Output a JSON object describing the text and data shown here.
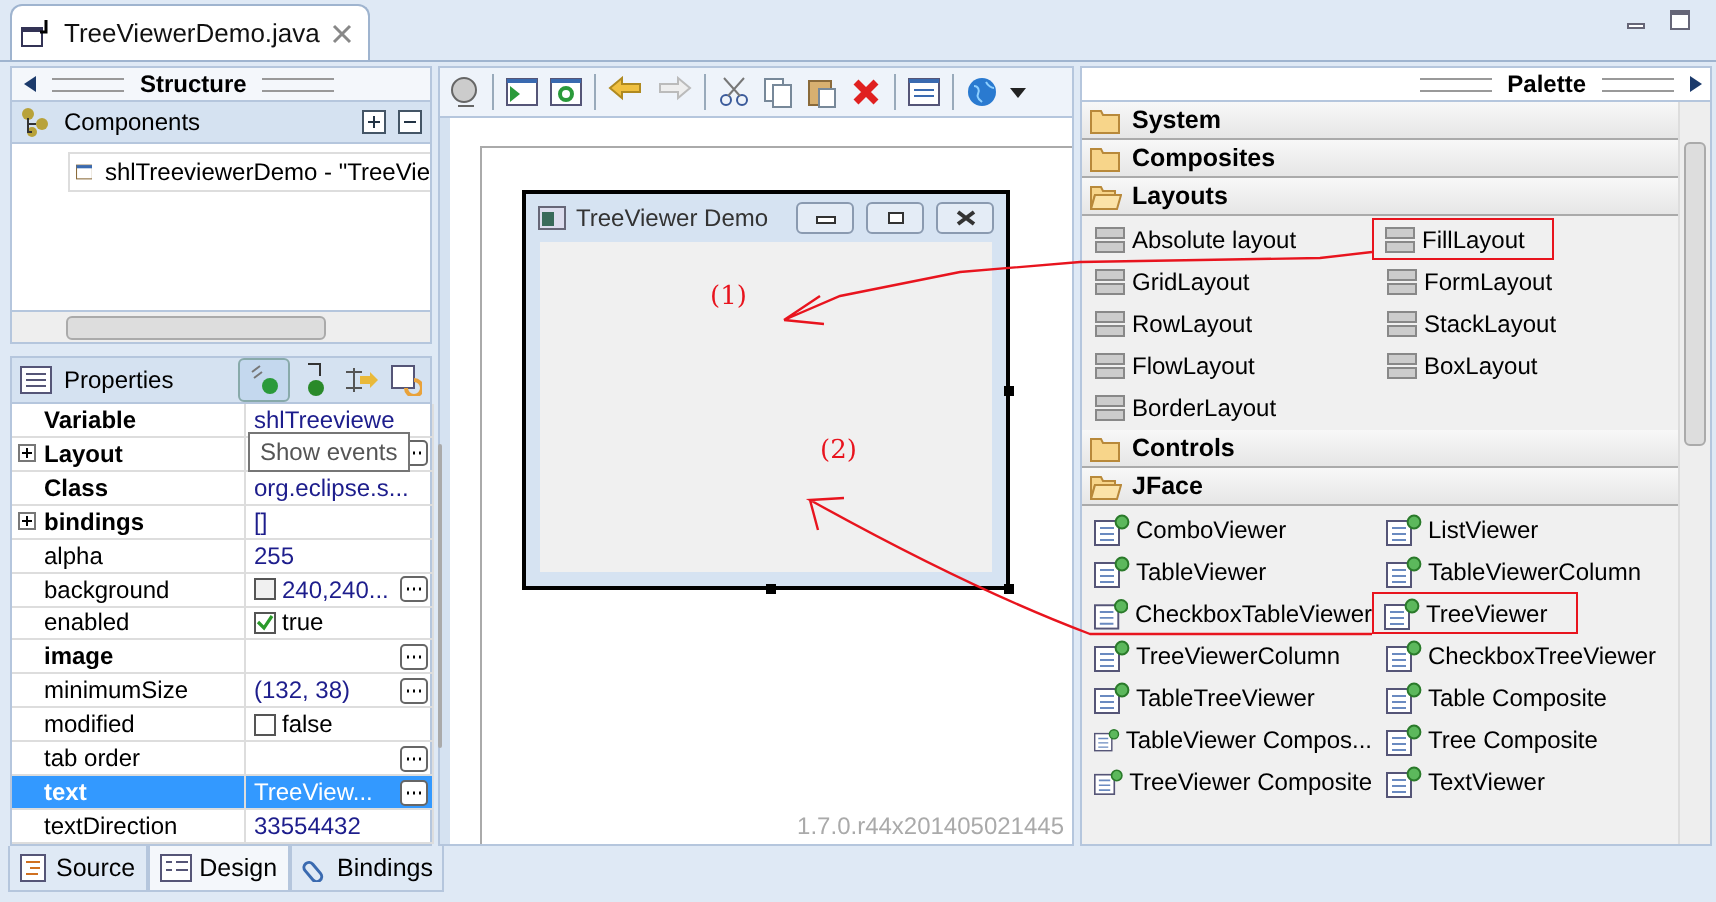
{
  "editor_tab": {
    "title": "TreeViewerDemo.java"
  },
  "structure": {
    "title": "Structure",
    "components_title": "Components",
    "tree": [
      {
        "label": "shlTreeviewerDemo - \"TreeVie",
        "selected": false
      }
    ]
  },
  "properties": {
    "title": "Properties",
    "tooltip": "Show events",
    "rows": [
      {
        "name": "Variable",
        "bold": true,
        "expandable": false,
        "kind": "text",
        "value": "shlTreeviewe",
        "button": false,
        "selected": false
      },
      {
        "name": "Layout",
        "bold": true,
        "expandable": true,
        "kind": "text",
        "button": true,
        "selected": false
      },
      {
        "name": "Class",
        "bold": true,
        "expandable": false,
        "kind": "text",
        "value": "org.eclipse.s...",
        "button": false,
        "selected": false
      },
      {
        "name": "bindings",
        "bold": true,
        "expandable": true,
        "kind": "text",
        "value": "[]",
        "button": false,
        "selected": false
      },
      {
        "name": "alpha",
        "bold": false,
        "expandable": false,
        "kind": "text",
        "value": "255",
        "button": false,
        "selected": false
      },
      {
        "name": "background",
        "bold": false,
        "expandable": false,
        "kind": "color",
        "value": "240,240...",
        "button": true,
        "selected": false
      },
      {
        "name": "enabled",
        "bold": false,
        "expandable": false,
        "kind": "check",
        "checked": true,
        "value": "true",
        "button": false,
        "selected": false
      },
      {
        "name": "image",
        "bold": true,
        "expandable": false,
        "kind": "text",
        "button": true,
        "selected": false
      },
      {
        "name": "minimumSize",
        "bold": false,
        "expandable": false,
        "kind": "text",
        "value": "(132, 38)",
        "button": true,
        "selected": false
      },
      {
        "name": "modified",
        "bold": false,
        "expandable": false,
        "kind": "check",
        "checked": false,
        "value": "false",
        "button": false,
        "selected": false
      },
      {
        "name": "tab order",
        "bold": false,
        "expandable": false,
        "kind": "text",
        "button": true,
        "selected": false
      },
      {
        "name": "text",
        "bold": true,
        "expandable": false,
        "kind": "text",
        "value": "TreeView...",
        "button": true,
        "selected": true
      },
      {
        "name": "textDirection",
        "bold": false,
        "expandable": false,
        "kind": "text",
        "value": "33554432",
        "button": false,
        "selected": false
      }
    ]
  },
  "design": {
    "window_title": "TreeViewer Demo",
    "version": "1.7.0.r44x201405021445"
  },
  "annotations": [
    "(1)",
    "(2)"
  ],
  "palette": {
    "title": "Palette",
    "categories": [
      {
        "name": "System",
        "expanded": false
      },
      {
        "name": "Composites",
        "expanded": false
      },
      {
        "name": "Layouts",
        "expanded": true,
        "items": [
          {
            "label": "Absolute layout",
            "highlighted": false
          },
          {
            "label": "FillLayout",
            "highlighted": true
          },
          {
            "label": "GridLayout",
            "highlighted": false
          },
          {
            "label": "FormLayout",
            "highlighted": false
          },
          {
            "label": "RowLayout",
            "highlighted": false
          },
          {
            "label": "StackLayout",
            "highlighted": false
          },
          {
            "label": "FlowLayout",
            "highlighted": false
          },
          {
            "label": "BoxLayout",
            "highlighted": false
          },
          {
            "label": "BorderLayout",
            "highlighted": false
          }
        ]
      },
      {
        "name": "Controls",
        "expanded": false
      },
      {
        "name": "JFace",
        "expanded": true,
        "items": [
          {
            "label": "ComboViewer",
            "highlighted": false
          },
          {
            "label": "ListViewer",
            "highlighted": false
          },
          {
            "label": "TableViewer",
            "highlighted": false
          },
          {
            "label": "TableViewerColumn",
            "highlighted": false
          },
          {
            "label": "CheckboxTableViewer",
            "highlighted": false
          },
          {
            "label": "TreeViewer",
            "highlighted": true
          },
          {
            "label": "TreeViewerColumn",
            "highlighted": false
          },
          {
            "label": "CheckboxTreeViewer",
            "highlighted": false
          },
          {
            "label": "TableTreeViewer",
            "highlighted": false
          },
          {
            "label": "Table Composite",
            "highlighted": false
          },
          {
            "label": "TableViewer Compos...",
            "highlighted": false
          },
          {
            "label": "Tree Composite",
            "highlighted": false
          },
          {
            "label": "TreeViewer Composite",
            "highlighted": false
          },
          {
            "label": "TextViewer",
            "highlighted": false
          }
        ]
      }
    ]
  },
  "bottom_tabs": [
    {
      "label": "Source",
      "selected": false
    },
    {
      "label": "Design",
      "selected": true
    },
    {
      "label": "Bindings",
      "selected": false
    }
  ]
}
